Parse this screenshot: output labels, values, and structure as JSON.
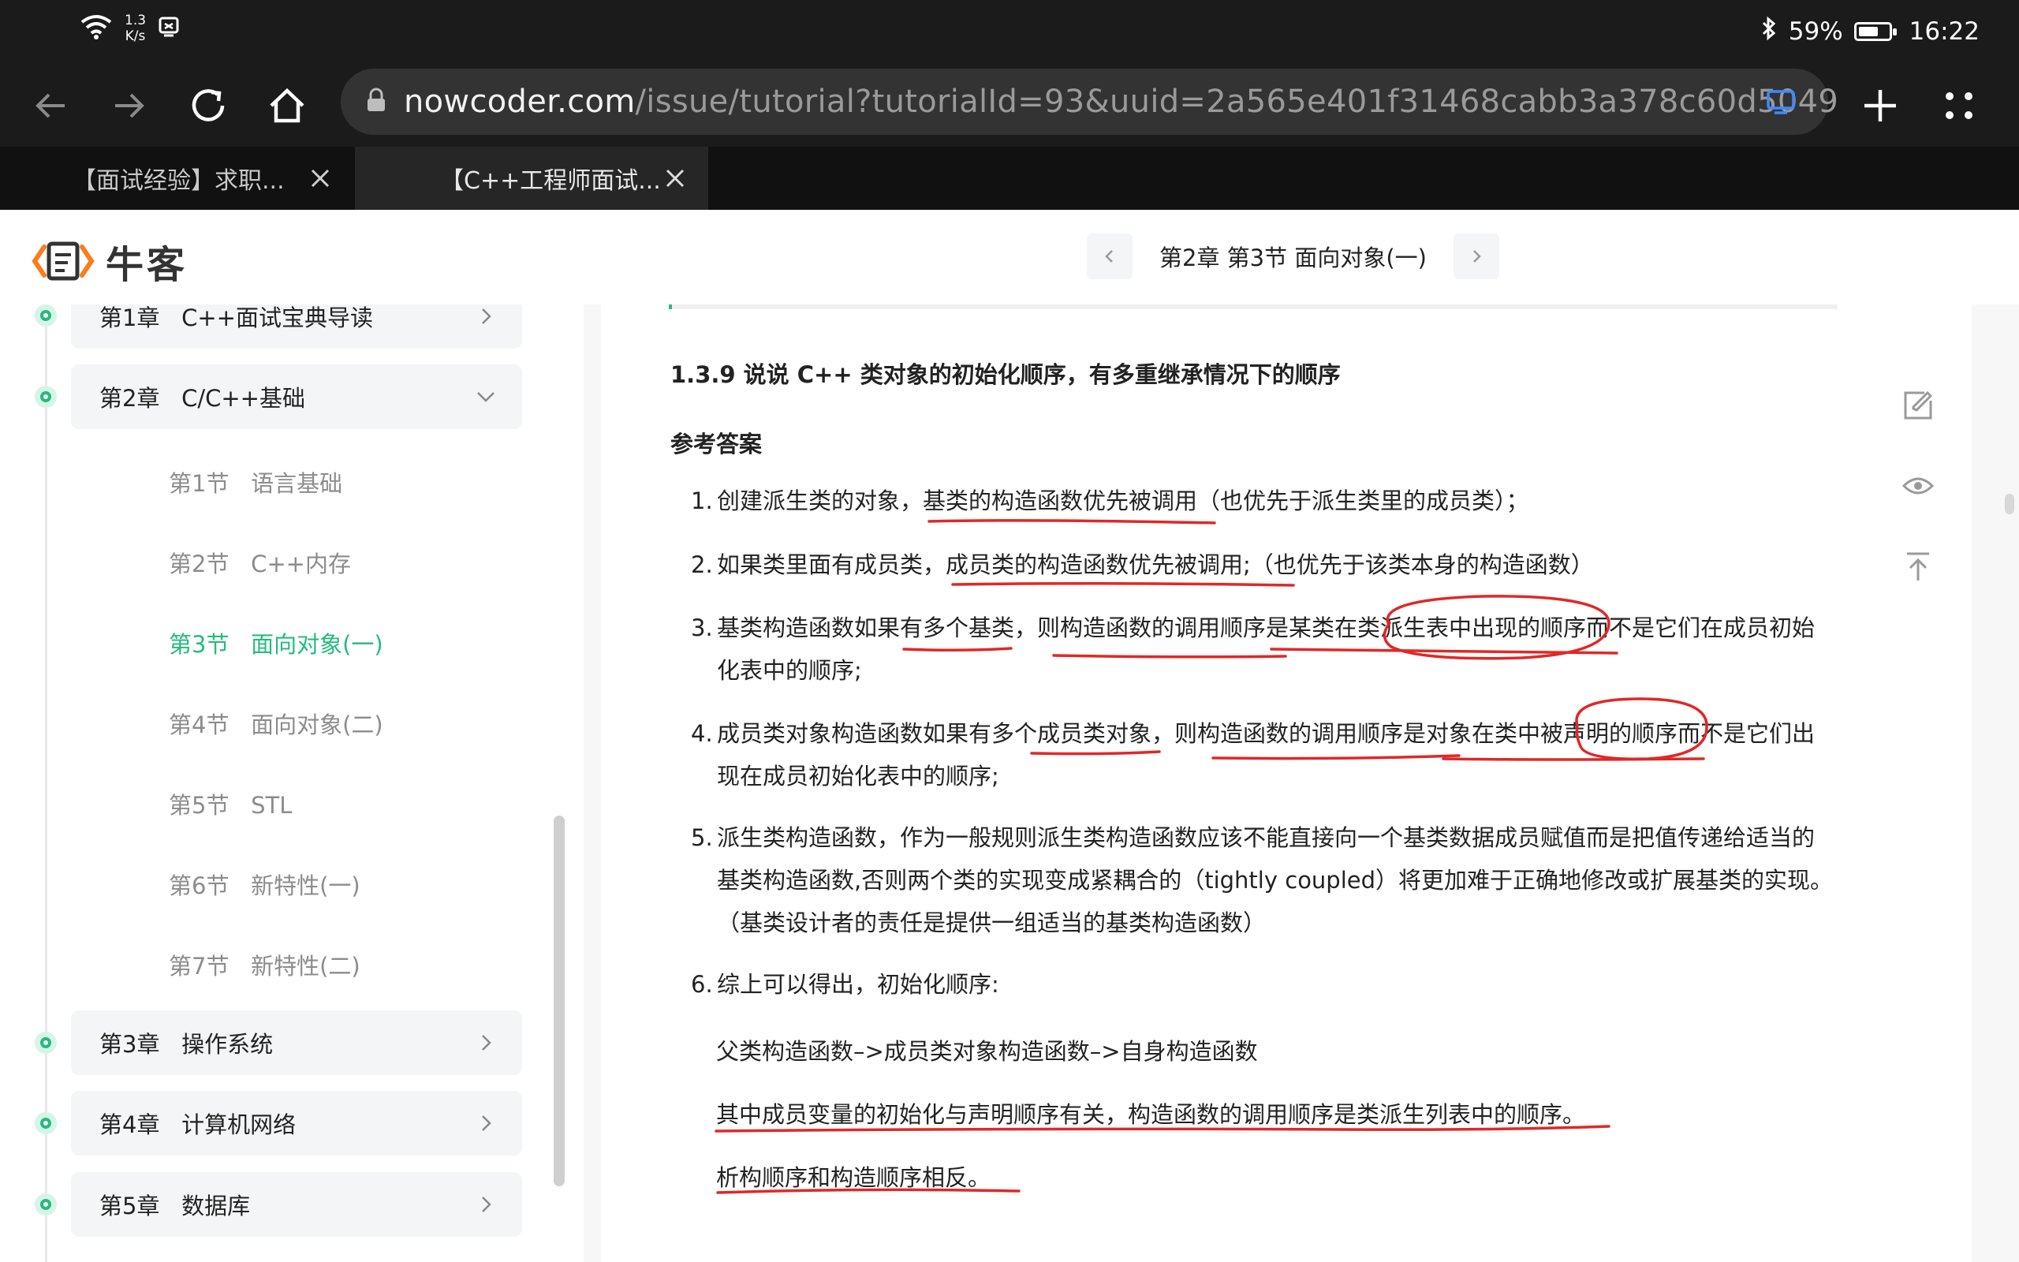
{
  "status_bar": {
    "net_speed_value": "1.3",
    "net_speed_unit": "K/s",
    "battery_percent": "59%",
    "battery_level": 0.59,
    "time": "16:22",
    "icons": [
      "wifi-icon",
      "sim-icon",
      "bluetooth-icon",
      "battery-icon"
    ]
  },
  "browser": {
    "url_domain": "nowcoder.com",
    "url_path": "/issue/tutorial?tutorialId=93&uuid=2a565e401f31468cabb3a378c60d5049",
    "tabs": [
      {
        "title": "【面试经验】求职面试经验分享",
        "display": "【面试经验】求职..."
      },
      {
        "title": "【C++工程师面试宝典】",
        "display": "【C++工程师面试..."
      }
    ],
    "active_tab": 1
  },
  "header": {
    "logo_text": "牛客",
    "chapter_nav_title": "第2章 第3节 面向对象(一)"
  },
  "sidebar": {
    "chapters": [
      {
        "label": "第1章   C++面试宝典导读",
        "expanded": false
      },
      {
        "label": "第2章   C/C++基础",
        "expanded": true
      },
      {
        "label": "第3章   操作系统",
        "expanded": false
      },
      {
        "label": "第4章   计算机网络",
        "expanded": false
      },
      {
        "label": "第5章   数据库",
        "expanded": false
      }
    ],
    "sections": [
      {
        "label": "第1节   语言基础",
        "active": false
      },
      {
        "label": "第2节   C++内存",
        "active": false
      },
      {
        "label": "第3节   面向对象(一)",
        "active": true
      },
      {
        "label": "第4节   面向对象(二)",
        "active": false
      },
      {
        "label": "第5节   STL",
        "active": false
      },
      {
        "label": "第6节   新特性(一)",
        "active": false
      },
      {
        "label": "第7节   新特性(二)",
        "active": false
      }
    ]
  },
  "content": {
    "question_title": "1.3.9 说说 C++ 类对象的初始化顺序，有多重继承情况下的顺序",
    "answer_heading": "参考答案",
    "items": [
      {
        "num": "1.",
        "text": "创建派生类的对象，基类的构造函数优先被调用（也优先于派生类里的成员类）；"
      },
      {
        "num": "2.",
        "text": "如果类里面有成员类，成员类的构造函数优先被调用;（也优先于该类本身的构造函数）"
      },
      {
        "num": "3.",
        "text": "基类构造函数如果有多个基类，则构造函数的调用顺序是某类在类派生表中出现的顺序而不是它们在成员初始化表中的顺序;"
      },
      {
        "num": "4.",
        "text": "成员类对象构造函数如果有多个成员类对象，则构造函数的调用顺序是对象在类中被声明的顺序而不是它们出现在成员初始化表中的顺序;"
      },
      {
        "num": "5.",
        "text": "派生类构造函数，作为一般规则派生类构造函数应该不能直接向一个基类数据成员赋值而是把值传递给适当的基类构造函数,否则两个类的实现变成紧耦合的（tightly coupled）将更加难于正确地修改或扩展基类的实现。（基类设计者的责任是提供一组适当的基类构造函数）"
      },
      {
        "num": "6.",
        "text": "综上可以得出，初始化顺序:"
      }
    ],
    "summary_lines": [
      "父类构造函数–>成员类对象构造函数–>自身构造函数",
      "其中成员变量的初始化与声明顺序有关，构造函数的调用顺序是类派生列表中的顺序。",
      "析构顺序和构造顺序相反。"
    ]
  },
  "float_tools": [
    "edit-note-icon",
    "eye-icon",
    "back-to-top-icon"
  ],
  "colors": {
    "accent_green": "#25bb7d",
    "browser_dark": "#1b1b1b",
    "annotation_red": "#e02828"
  }
}
